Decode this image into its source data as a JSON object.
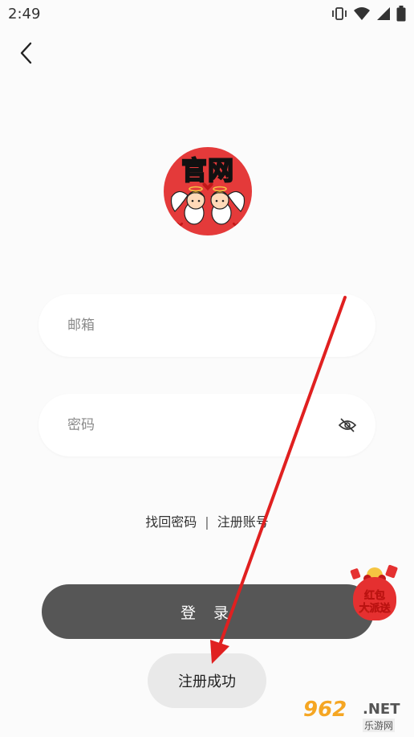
{
  "status_bar": {
    "time": "2:49",
    "icons": [
      "vibrate-icon",
      "wifi-icon",
      "no-sim-icon",
      "battery-icon"
    ]
  },
  "nav": {
    "back_icon": "chevron-left-icon"
  },
  "logo": {
    "text": "官网",
    "icon": "angel-logo"
  },
  "form": {
    "email_placeholder": "邮箱",
    "email_value": "",
    "password_placeholder": "密码",
    "password_value": "",
    "eye_icon": "eye-slash-icon"
  },
  "links": {
    "forgot_password": "找回密码",
    "separator": "|",
    "register": "注册账号"
  },
  "login_button": "登 录",
  "toast": "注册成功",
  "floating_ad": {
    "line1": "红包",
    "line2": "大派送"
  },
  "watermark": {
    "number": "962",
    "domain": ".NET",
    "site": "乐游网"
  },
  "colors": {
    "background": "#fbfbfb",
    "login_button": "#565656",
    "arrow": "#e02020",
    "logo_bg": "#e43a3a"
  }
}
